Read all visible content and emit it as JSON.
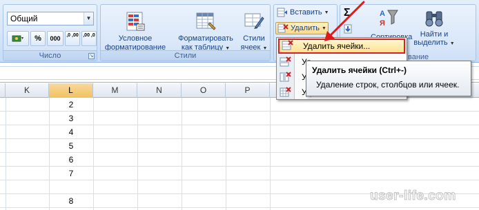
{
  "number_group": {
    "format_value": "Общий",
    "percent_label": "%",
    "thousands_label": "000",
    "inc_decimals_label": ",0 ,00",
    "dec_decimals_label": ",00 ,0",
    "group_label": "Число"
  },
  "styles_group": {
    "conditional_formatting": [
      "Условное",
      "форматирование"
    ],
    "format_as_table": [
      "Форматировать",
      "как таблицу"
    ],
    "cell_styles": [
      "Стили",
      "ячеек"
    ],
    "group_label": "Стили"
  },
  "cells_group": {
    "insert_label": "Вставить",
    "delete_label": "Удалить",
    "group_label_partial": "вание"
  },
  "editing_group": {
    "sum_symbol": "Σ",
    "sort_partial": "Сортировка",
    "find_select": [
      "Найти и",
      "выделить"
    ]
  },
  "column_headers": [
    "K",
    "L",
    "M",
    "N",
    "O",
    "P"
  ],
  "selected_column": "L",
  "cells_L": [
    "2",
    "3",
    "4",
    "5",
    "6",
    "7",
    "",
    "8"
  ],
  "delete_menu": {
    "items": [
      {
        "label": "Удалить ячейки...",
        "highlighted": true
      },
      {
        "label": "Уд",
        "highlighted": false
      },
      {
        "label": "Уд",
        "highlighted": false
      },
      {
        "label": "Удалить лист",
        "highlighted": false
      }
    ]
  },
  "tooltip": {
    "title": "Удалить ячейки (Ctrl+-)",
    "description": "Удаление строк, столбцов или ячеек."
  },
  "watermark": "user-life.com",
  "colors": {
    "ribbon_bg": "#d6e5f8",
    "selected_header": "#f1c15f",
    "highlight_border": "#d92020",
    "arrow": "#e01818"
  }
}
